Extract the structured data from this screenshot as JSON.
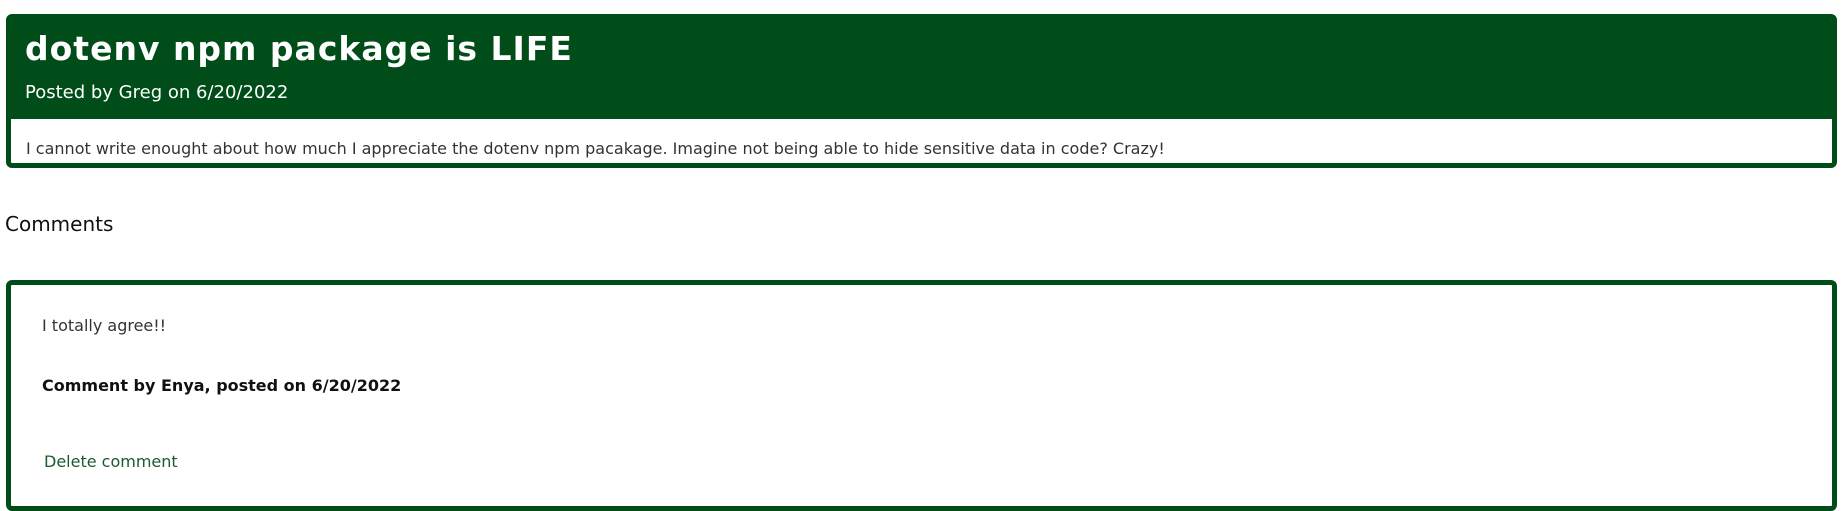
{
  "post": {
    "title": "dotenv npm package is LIFE",
    "meta": "Posted by Greg on 6/20/2022",
    "body": "I cannot write enought about how much I appreciate the dotenv npm pacakage. Imagine not being able to hide sensitive data in code? Crazy!"
  },
  "comments_section": {
    "heading": "Comments",
    "items": [
      {
        "text": "I totally agree!!",
        "meta": "Comment by Enya, posted on 6/20/2022",
        "delete_label": "Delete comment"
      }
    ]
  },
  "colors": {
    "accent": "#004d1a",
    "link": "#1c5a2e"
  }
}
